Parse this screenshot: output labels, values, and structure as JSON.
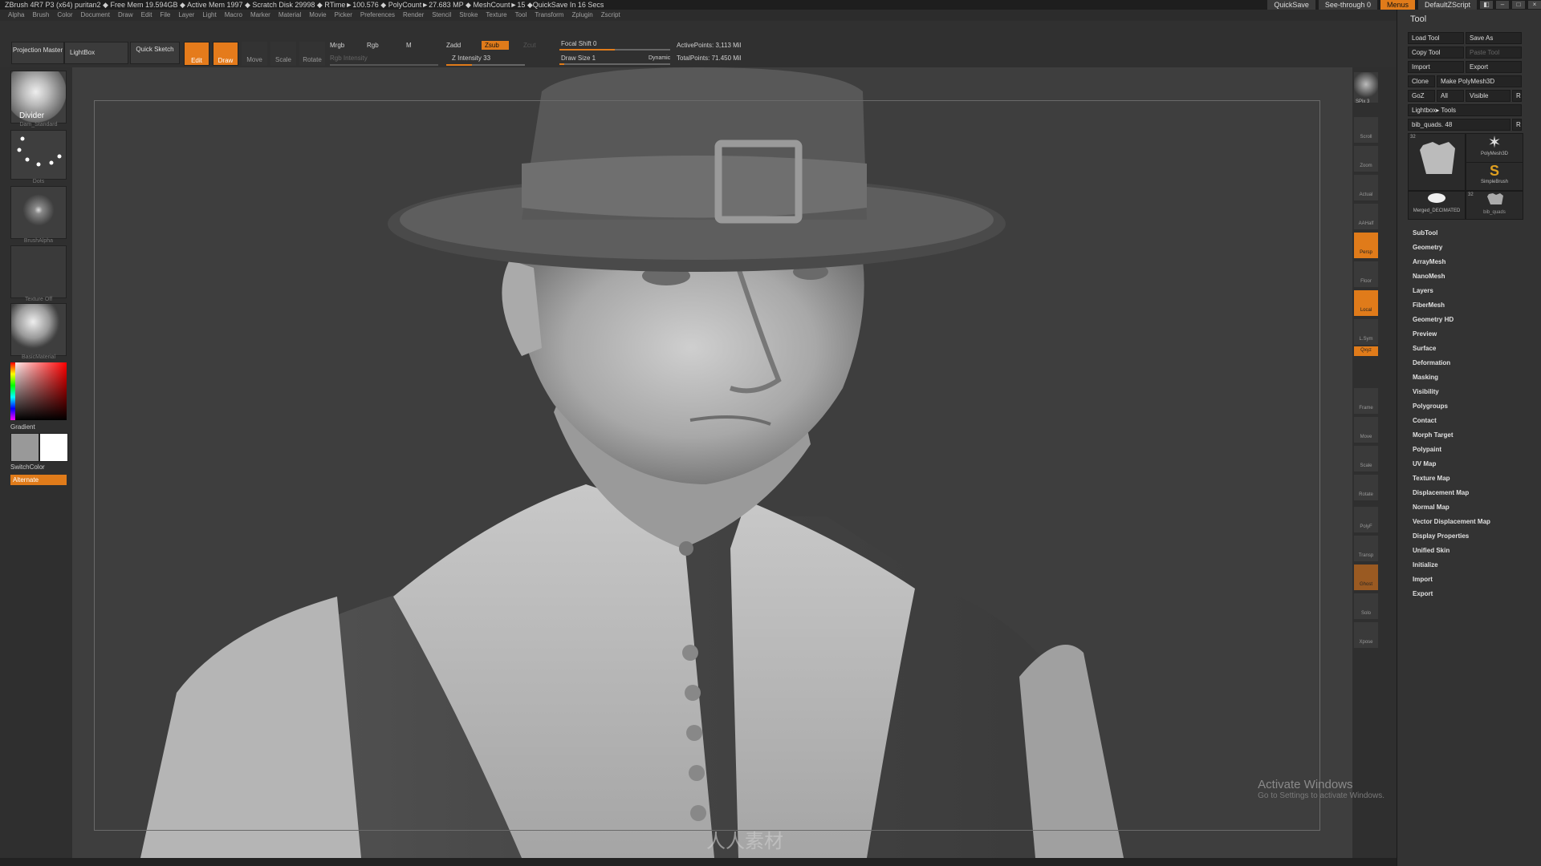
{
  "titlebar": {
    "text": "ZBrush 4R7 P3 (x64)   puritan2   ◆ Free Mem 19.594GB ◆ Active Mem 1997 ◆ Scratch Disk 29998 ◆  RTime►100.576 ◆ PolyCount►27.683 MP ◆ MeshCount►15  ◆QuickSave In 16 Secs",
    "quicksave": "QuickSave",
    "seethrough": "See-through  0",
    "menus": "Menus",
    "script": "DefaultZScript"
  },
  "menubar": [
    "Alpha",
    "Brush",
    "Color",
    "Document",
    "Draw",
    "Edit",
    "File",
    "Layer",
    "Light",
    "Macro",
    "Marker",
    "Material",
    "Movie",
    "Picker",
    "Preferences",
    "Render",
    "Stencil",
    "Stroke",
    "Texture",
    "Tool",
    "Transform",
    "Zplugin",
    "Zscript"
  ],
  "toolbar": {
    "projection_master": "Projection Master",
    "lightbox": "LightBox",
    "quick_sketch": "Quick Sketch",
    "edit": "Edit",
    "draw": "Draw",
    "move": "Move",
    "scale": "Scale",
    "rotate": "Rotate",
    "mrgb": "Mrgb",
    "rgb": "Rgb",
    "m": "M",
    "zadd": "Zadd",
    "zsub": "Zsub",
    "zcut": "Zcut",
    "rgb_intensity": "Rgb Intensity",
    "z_intensity": "Z Intensity 33",
    "focal_shift": "Focal Shift 0",
    "draw_size": "Draw Size 1",
    "dynamic": "Dynamic",
    "active_points": "ActivePoints: 3,113 Mil",
    "total_points": "TotalPoints: 71.450 Mil",
    "z_intensity_value": 33,
    "draw_size_value": 1
  },
  "leftshelf": {
    "brush_name": "Divider",
    "brush_caption": "Dam_Standard",
    "stroke_caption": "Dots",
    "alpha_caption": "BrushAlpha",
    "texture_caption": "Texture Off",
    "material_caption": "BasicMaterial",
    "gradient": "Gradient",
    "switchcolor": "SwitchColor",
    "alternate": "Alternate"
  },
  "rightshelf": {
    "spix": "SPix 3",
    "buttons": [
      "Scroll",
      "Zoom",
      "Actual",
      "AAHalf",
      "Persp",
      "Floor",
      "Local",
      "L.Sym",
      "Qxyz",
      "Frame",
      "Move",
      "Scale",
      "Rotate",
      "PolyF",
      "Transp",
      "Ghost",
      "Solo",
      "Xpose"
    ]
  },
  "panel": {
    "title": "Tool",
    "load_tool": "Load Tool",
    "save_as": "Save As",
    "copy_tool": "Copy Tool",
    "paste_tool": "Paste Tool",
    "import": "Import",
    "export": "Export",
    "clone": "Clone",
    "make_polymesh": "Make PolyMesh3D",
    "goz": "GoZ",
    "all": "All",
    "visible": "Visible",
    "r": "R",
    "lightbox_tools": "Lightbox▸ Tools",
    "current_tool": "bib_quads. 48",
    "thumb_polymesh": "PolyMesh3D",
    "thumb_simplebrush": "SimpleBrush",
    "thumb_merged": "Merged_DECIMATED",
    "thumb_bib": "bib_quads",
    "thumb_count_a": "32",
    "thumb_count_b": "32",
    "sections": [
      "SubTool",
      "Geometry",
      "ArrayMesh",
      "NanoMesh",
      "Layers",
      "FiberMesh",
      "Geometry HD",
      "Preview",
      "Surface",
      "Deformation",
      "Masking",
      "Visibility",
      "Polygroups",
      "Contact",
      "Morph Target",
      "Polypaint",
      "UV Map",
      "Texture Map",
      "Displacement Map",
      "Normal Map",
      "Vector Displacement Map",
      "Display Properties",
      "Unified Skin",
      "Initialize",
      "Import",
      "Export"
    ]
  },
  "watermark": {
    "line1": "Activate Windows",
    "line2": "Go to Settings to activate Windows.",
    "logo_text": "人人素材"
  },
  "colors": {
    "accent": "#e07b1a",
    "background": "#2a2a2a",
    "canvas": "#3e3e3e"
  }
}
